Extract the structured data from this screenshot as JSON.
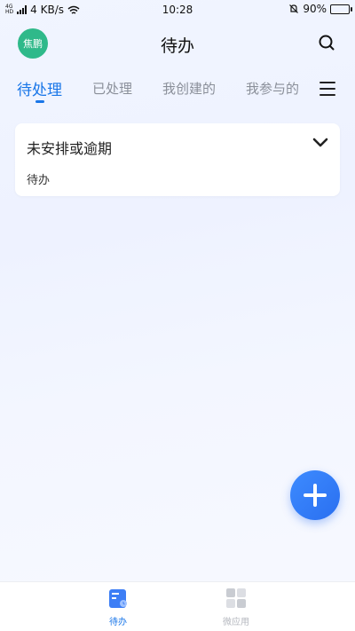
{
  "status_bar": {
    "network_tag_top": "4G",
    "network_tag_bottom": "HD",
    "speed": "4 KB/s",
    "time": "10:28",
    "battery": "90%"
  },
  "header": {
    "avatar_text": "焦鹏",
    "title": "待办",
    "avatar_color": "#2fb98a"
  },
  "tabs": [
    {
      "label": "待处理",
      "active": true
    },
    {
      "label": "已处理",
      "active": false
    },
    {
      "label": "我创建的",
      "active": false
    },
    {
      "label": "我参与的",
      "active": false
    }
  ],
  "card": {
    "title": "未安排或逾期",
    "subtitle": "待办"
  },
  "bottom_nav": [
    {
      "label": "待办",
      "active": true
    },
    {
      "label": "微应用",
      "active": false
    }
  ],
  "colors": {
    "accent": "#1976e8",
    "fab": "#2a6ff0"
  }
}
